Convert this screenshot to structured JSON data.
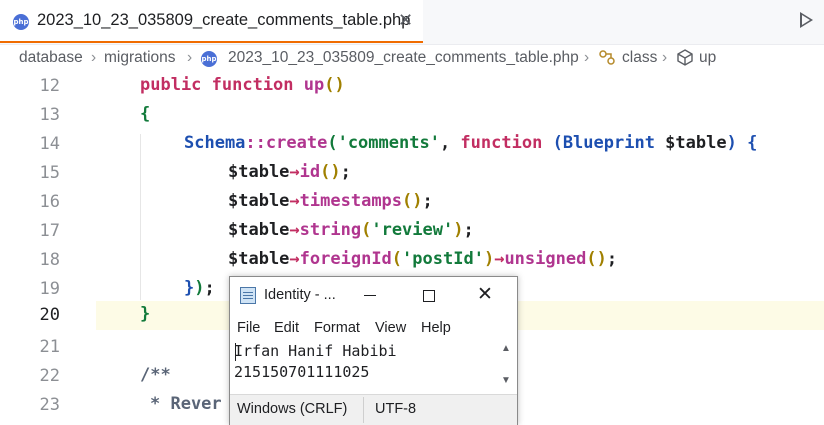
{
  "tab": {
    "title": "2023_10_23_035809_create_comments_table.php",
    "close": "✕",
    "badge": "php"
  },
  "breadcrumb": {
    "items": [
      "database",
      "migrations",
      "2023_10_23_035809_create_comments_table.php",
      "class",
      "up"
    ],
    "sep": "›"
  },
  "editor": {
    "line_numbers": [
      "12",
      "13",
      "14",
      "15",
      "16",
      "17",
      "18",
      "19",
      "20",
      "21",
      "22",
      "23"
    ],
    "current_line": "20",
    "lines": {
      "l12": {
        "kw": "public function",
        "fn": "up",
        "paren": "()"
      },
      "l13": {
        "brace": "{"
      },
      "l14": {
        "cls": "Schema",
        "op": "::",
        "fn": "create",
        "open": "(",
        "str": "'comments'",
        "comma": ", ",
        "kw": "function",
        "sp": " ",
        "open2": "(",
        "cls2": "Blueprint",
        "var": " $table",
        "close2": ")",
        "brace": " {"
      },
      "l15": {
        "var": "$table",
        "arrow": "→",
        "fn": "id",
        "paren": "()",
        "semi": ";"
      },
      "l16": {
        "var": "$table",
        "arrow": "→",
        "fn": "timestamps",
        "paren": "()",
        "semi": ";"
      },
      "l17": {
        "var": "$table",
        "arrow": "→",
        "fn": "string",
        "open": "(",
        "str": "'review'",
        "close": ")",
        "semi": ";"
      },
      "l18": {
        "var": "$table",
        "arrow": "→",
        "fn": "foreignId",
        "open": "(",
        "str": "'postId'",
        "close": ")",
        "arrow2": "→",
        "fn2": "unsigned",
        "paren": "()",
        "semi": ";"
      },
      "l19": {
        "brace": "}",
        "paren": ")",
        "semi": ";"
      },
      "l20": {
        "brace": "}"
      },
      "l22": {
        "cmt": "/**"
      },
      "l23": {
        "cmt": "* Rever"
      }
    }
  },
  "notepad": {
    "title": "Identity - ...",
    "close": "✕",
    "menu": [
      "File",
      "Edit",
      "Format",
      "View",
      "Help"
    ],
    "text": "Irfan Hanif Habibi\n215150701111025",
    "status": {
      "line_ending": "Windows (CRLF)",
      "encoding": "UTF-8"
    },
    "scroll_up": "▲",
    "scroll_down": "▼"
  }
}
